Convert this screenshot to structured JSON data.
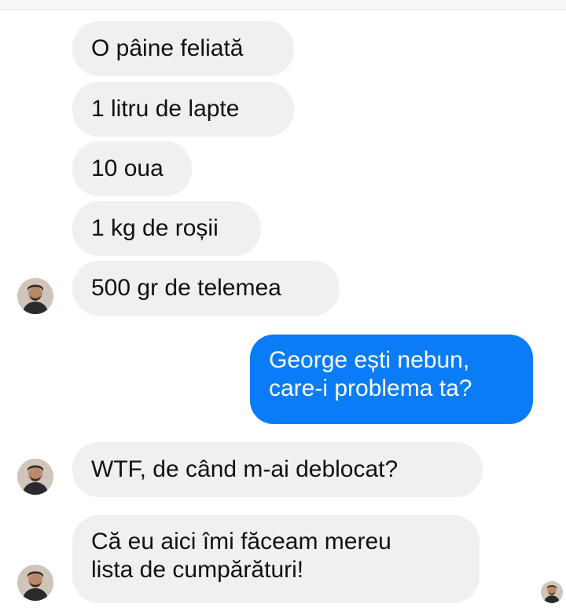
{
  "messages": [
    {
      "text": "O pâine feliată",
      "direction": "incoming"
    },
    {
      "text": "1 litru de lapte",
      "direction": "incoming"
    },
    {
      "text": "10 oua",
      "direction": "incoming"
    },
    {
      "text": "1 kg de roșii",
      "direction": "incoming"
    },
    {
      "text": "500 gr de telemea",
      "direction": "incoming"
    },
    {
      "lines": [
        "George ești nebun,",
        "care-i problema ta?"
      ],
      "direction": "outgoing"
    },
    {
      "text": "WTF, de când m-ai deblocat?",
      "direction": "incoming"
    },
    {
      "lines": [
        "Că eu aici îmi făceam mereu",
        "lista de cumpărături!"
      ],
      "direction": "incoming"
    }
  ],
  "avatar_icon": "contact-avatar-icon",
  "colors": {
    "incoming_bubble": "#f0f0f0",
    "outgoing_bubble": "#0b7cf7",
    "outgoing_text": "#ffffff"
  }
}
